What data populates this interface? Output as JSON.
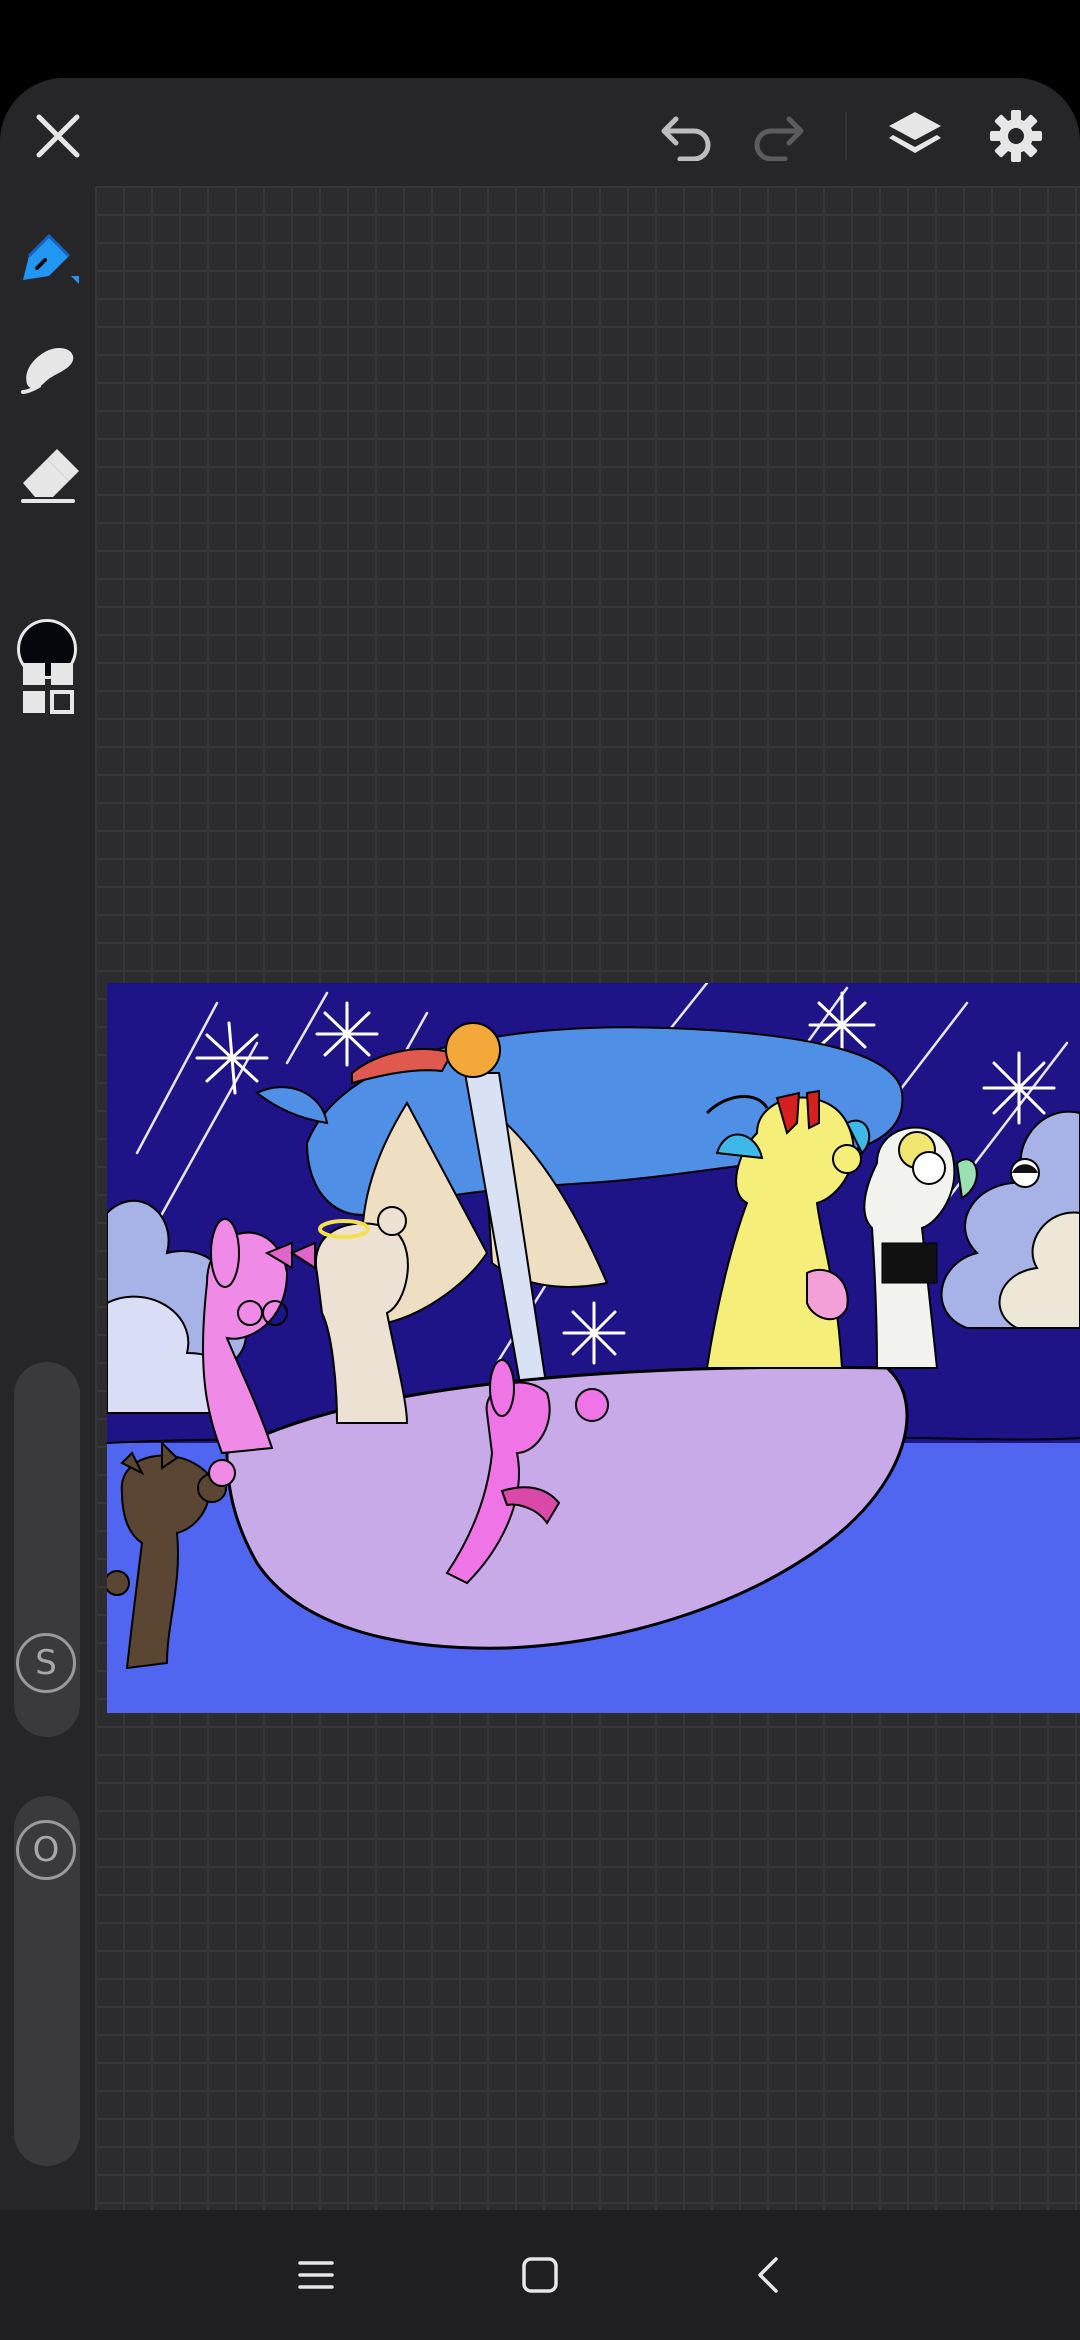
{
  "app": {
    "topbar_icons": [
      "close-icon",
      "undo-icon",
      "redo-icon",
      "layers-icon",
      "settings-icon"
    ],
    "left_tools": [
      "brush-icon",
      "smudge-icon",
      "eraser-icon",
      "color-swatch",
      "panels-icon"
    ]
  },
  "sliders": {
    "size_label": "S",
    "opacity_label": "O"
  },
  "colors": {
    "accent": "#2196f3",
    "current_brush_color": "#05070d",
    "background": "#262628",
    "canvas_grid": "#2c2c2e"
  },
  "navbar": {
    "icons": [
      "menu-icon",
      "home-icon",
      "back-icon"
    ]
  }
}
